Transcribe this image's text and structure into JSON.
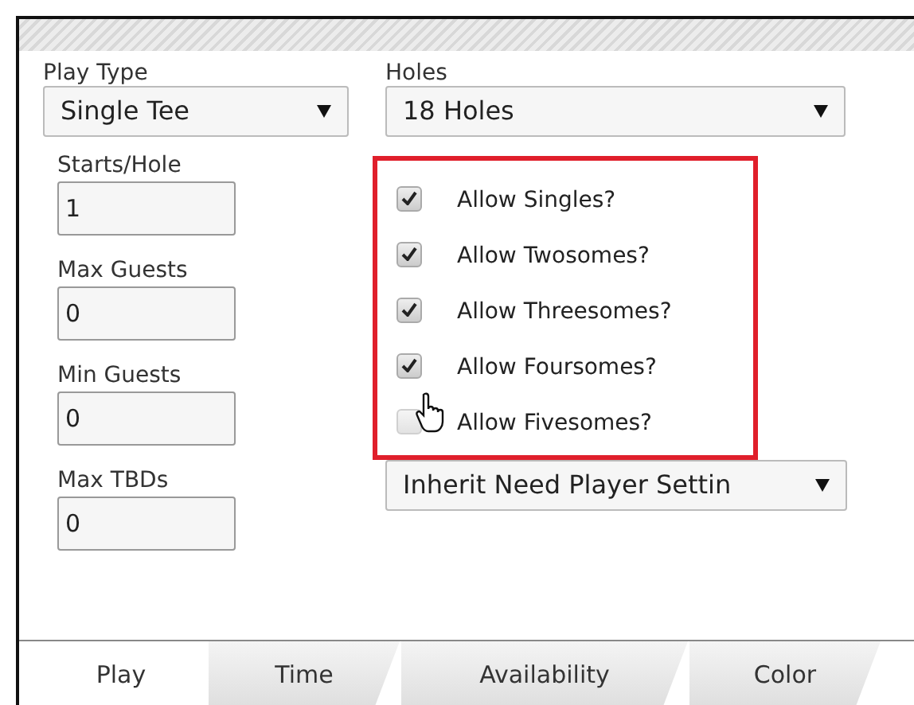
{
  "fields_top": [
    {
      "label": "Play Type",
      "value": "Single Tee"
    },
    {
      "label": "Holes",
      "value": "18 Holes"
    }
  ],
  "counts": [
    {
      "label": "Starts/Hole",
      "value": "1"
    },
    {
      "label": "Max Guests",
      "value": "0"
    },
    {
      "label": "Min Guests",
      "value": "0"
    },
    {
      "label": "Max TBDs",
      "value": "0"
    }
  ],
  "options": [
    {
      "label": "Allow Singles?",
      "checked": true
    },
    {
      "label": "Allow Twosomes?",
      "checked": true
    },
    {
      "label": "Allow Threesomes?",
      "checked": true
    },
    {
      "label": "Allow Foursomes?",
      "checked": true
    },
    {
      "label": "Allow Fivesomes?",
      "checked": false
    }
  ],
  "need_player": {
    "value": "Inherit Need Player Settin"
  },
  "tabs": [
    {
      "label": "Play",
      "selected": true
    },
    {
      "label": "Time",
      "selected": false
    },
    {
      "label": "Availability",
      "selected": false
    },
    {
      "label": "Color",
      "selected": false
    }
  ]
}
